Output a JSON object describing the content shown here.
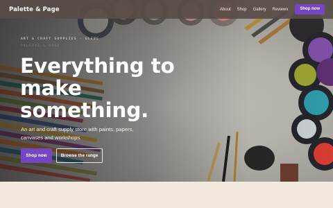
{
  "nav": {
    "brand": "Palette & Page",
    "links": [
      "About",
      "Shop",
      "Gallery",
      "Reviews"
    ],
    "cta": "Shop now"
  },
  "hero": {
    "eyebrow": "Art & craft supplies · Glebe",
    "eyebrow_ghost": "Palette & Page",
    "headline": "Everything to make something.",
    "subhead": "An art and craft supply store with paints, papers, canvases and workshops.",
    "primary_cta": "Shop now",
    "secondary_cta": "Browse the range"
  },
  "colors": {
    "accent": "#7446c2",
    "nav_bg": "#584c46",
    "page_bg": "#f3ebdf"
  }
}
